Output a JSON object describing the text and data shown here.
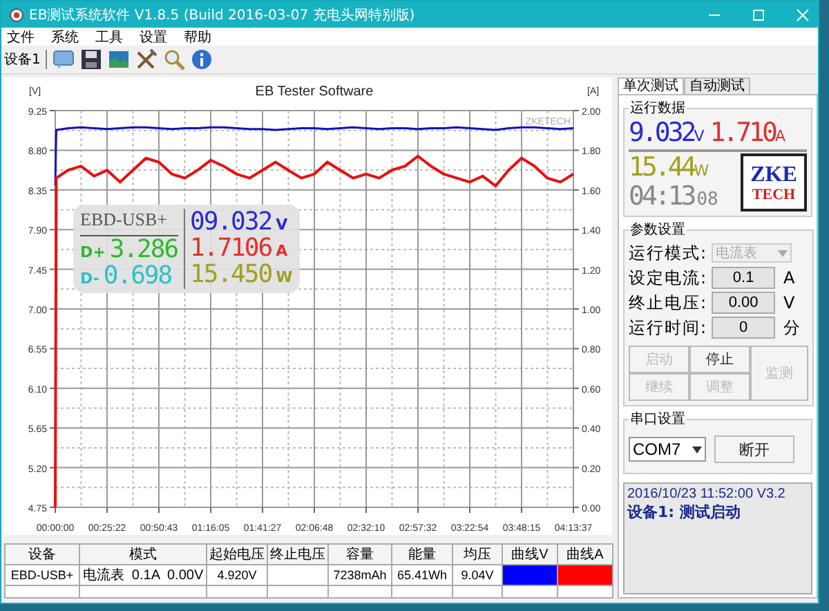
{
  "window": {
    "title": "EB测试系统软件 V1.8.5 (Build 2016-03-07 充电头网特别版)"
  },
  "menu": [
    "文件",
    "系统",
    "工具",
    "设置",
    "帮助"
  ],
  "toolbar": {
    "device": "设备1"
  },
  "chart": {
    "watermark": "ZKETECH",
    "left_unit": "[V]",
    "right_unit": "[A]",
    "overlay": {
      "model": "EBD-USB+",
      "voltage": "09.032",
      "voltage_unit": "V",
      "current": "1.7106",
      "current_unit": "A",
      "power": "15.450",
      "power_unit": "W",
      "dplus_label": "D+",
      "dplus": "3.286",
      "dminus_label": "D-",
      "dminus": "0.698"
    },
    "chart_data": {
      "type": "line",
      "title": "EB Tester Software",
      "grid": true,
      "x": [
        0,
        0.5,
        6.34,
        12.68,
        19.02,
        25.36,
        31.7,
        38.04,
        44.38,
        50.72,
        57.06,
        63.4,
        69.74,
        76.08,
        82.42,
        88.76,
        95.1,
        101.44,
        107.78,
        114.12,
        120.46,
        126.8,
        133.14,
        139.48,
        145.82,
        152.16,
        158.5,
        164.84,
        171.18,
        177.52,
        183.86,
        190.2,
        196.54,
        202.88,
        209.22,
        215.56,
        221.9,
        228.24,
        234.58,
        240.92,
        247.26,
        253.6
      ],
      "xlim": [
        0,
        253.62
      ],
      "xticks": [
        {
          "value": 0,
          "label": "00:00:00"
        },
        {
          "value": 25.37,
          "label": "00:25:22"
        },
        {
          "value": 50.72,
          "label": "00:50:43"
        },
        {
          "value": 76.08,
          "label": "01:16:05"
        },
        {
          "value": 101.45,
          "label": "01:41:27"
        },
        {
          "value": 126.8,
          "label": "02:06:48"
        },
        {
          "value": 152.17,
          "label": "02:32:10"
        },
        {
          "value": 177.53,
          "label": "02:57:32"
        },
        {
          "value": 202.9,
          "label": "03:22:54"
        },
        {
          "value": 228.25,
          "label": "03:48:15"
        },
        {
          "value": 253.62,
          "label": "04:13:37"
        }
      ],
      "ylim": [
        4.75,
        9.25
      ],
      "yticks": [
        {
          "value": 9.25,
          "label": "9.25"
        },
        {
          "value": 8.8,
          "label": "8.80"
        },
        {
          "value": 8.35,
          "label": "8.35"
        },
        {
          "value": 7.9,
          "label": "7.90"
        },
        {
          "value": 7.45,
          "label": "7.45"
        },
        {
          "value": 7.0,
          "label": "7.00"
        },
        {
          "value": 6.55,
          "label": "6.55"
        },
        {
          "value": 6.1,
          "label": "6.10"
        },
        {
          "value": 5.65,
          "label": "5.65"
        },
        {
          "value": 5.2,
          "label": "5.20"
        },
        {
          "value": 4.75,
          "label": "4.75"
        }
      ],
      "y2lim": [
        0,
        2
      ],
      "y2ticks": [
        {
          "value": 2,
          "label": "2.00"
        },
        {
          "value": 1.8,
          "label": "1.80"
        },
        {
          "value": 1.6,
          "label": "1.60"
        },
        {
          "value": 1.4,
          "label": "1.40"
        },
        {
          "value": 1.2,
          "label": "1.20"
        },
        {
          "value": 1.0,
          "label": "1.00"
        },
        {
          "value": 0.8,
          "label": "0.80"
        },
        {
          "value": 0.6,
          "label": "0.60"
        },
        {
          "value": 0.4,
          "label": "0.40"
        },
        {
          "value": 0.2,
          "label": "0.20"
        },
        {
          "value": 0,
          "label": "0.00"
        }
      ],
      "series": [
        {
          "color": "#1010c0",
          "values": [
            8.4,
            9.03,
            9.05,
            9.06,
            9.05,
            9.04,
            9.05,
            9.06,
            9.06,
            9.05,
            9.04,
            9.05,
            9.05,
            9.06,
            9.06,
            9.05,
            9.04,
            9.04,
            9.03,
            9.04,
            9.05,
            9.05,
            9.04,
            9.05,
            9.06,
            9.05,
            9.04,
            9.05,
            9.05,
            9.04,
            9.05,
            9.05,
            9.06,
            9.05,
            9.04,
            9.03,
            9.05,
            9.06,
            9.06,
            9.05,
            9.04,
            9.05
          ]
        },
        {
          "axis": "y2",
          "color": "#e81010",
          "values": [
            0.0,
            1.66,
            1.7,
            1.72,
            1.67,
            1.7,
            1.64,
            1.7,
            1.76,
            1.74,
            1.68,
            1.66,
            1.7,
            1.75,
            1.72,
            1.68,
            1.66,
            1.7,
            1.74,
            1.7,
            1.66,
            1.68,
            1.74,
            1.7,
            1.66,
            1.68,
            1.66,
            1.7,
            1.72,
            1.77,
            1.72,
            1.68,
            1.66,
            1.64,
            1.67,
            1.62,
            1.7,
            1.76,
            1.72,
            1.66,
            1.64,
            1.68
          ]
        }
      ]
    }
  },
  "table": {
    "columns": [
      "设备",
      "模式",
      "起始电压",
      "终止电压",
      "容量",
      "能量",
      "均压",
      "曲线V",
      "曲线A"
    ],
    "rows": [
      {
        "device": "EBD-USB+",
        "mode": "电流表  0.1A  0.00V",
        "start_voltage": "4.920V",
        "capacity": "7238mAh",
        "energy": "65.41Wh",
        "avg_voltage": "9.04V",
        "curves": [
          {
            "color": "#0000ff"
          },
          {
            "color": "#ff0000"
          }
        ]
      }
    ]
  },
  "tabs": [
    {
      "label": "单次测试",
      "selected": true
    },
    {
      "label": "自动测试",
      "selected": false
    }
  ],
  "run_data": {
    "title": "运行数据",
    "voltage": "9.032",
    "voltage_unit": "V",
    "current": "1.710",
    "current_unit": "A",
    "power": "15.44",
    "power_unit": "W",
    "time": "04:13",
    "seconds": "08",
    "logo_top": "ZKE",
    "logo_bottom": "TECH"
  },
  "params": {
    "title": "参数设置",
    "fields": [
      {
        "label": "运行模式:",
        "kind": "dropdown",
        "value": "电流表",
        "disabled": true
      },
      {
        "label": "设定电流:",
        "kind": "input",
        "value": "0.1",
        "unit": "A"
      },
      {
        "label": "终止电压:",
        "kind": "input",
        "value": "0.00",
        "unit": "V"
      },
      {
        "label": "运行时间:",
        "kind": "input",
        "value": "0",
        "unit": "分"
      }
    ],
    "buttons": [
      {
        "label": "启动",
        "disabled": true
      },
      {
        "label": "停止",
        "disabled": false
      },
      {
        "label": "继续",
        "disabled": true
      },
      {
        "label": "调整",
        "disabled": true
      }
    ],
    "monitor_button": {
      "label": "监测",
      "disabled": true
    }
  },
  "serial": {
    "title": "串口设置",
    "port": "COM7",
    "button": "断开"
  },
  "log": [
    "2016/10/23 11:52:00  V3.2",
    "设备1: 测试启动"
  ]
}
